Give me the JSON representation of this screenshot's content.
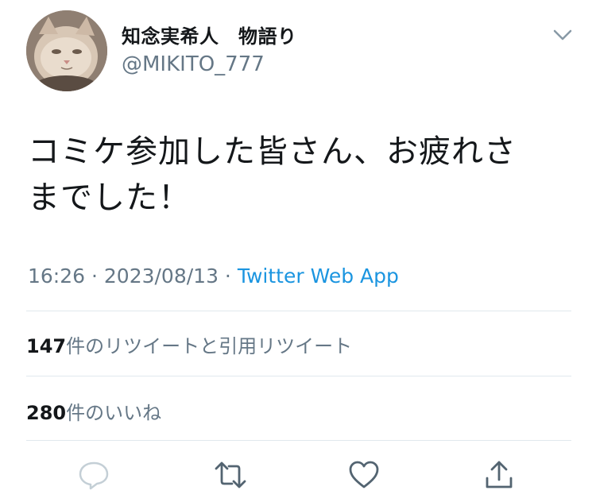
{
  "tweet": {
    "display_name": "知念実希人　物語り",
    "handle": "@MIKITO_777",
    "text_line1": "コミケ参加した皆さん、お疲れさ",
    "text_line2": "までした！",
    "time": "16:26",
    "date": "2023/08/13",
    "source": "Twitter Web App"
  },
  "stats": {
    "retweets_count": "147",
    "retweets_label": "件のリツイートと引用リツイート",
    "likes_count": "280",
    "likes_label": "件のいいね"
  },
  "icons": {
    "avatar": "cat-photo",
    "menu": "chevron-down-icon",
    "reply": "reply-icon",
    "retweet": "retweet-icon",
    "like": "heart-icon",
    "share": "share-icon"
  },
  "colors": {
    "text": "#14171a",
    "secondary": "#657786",
    "link": "#1b95e0",
    "divider": "#e1e8ed"
  }
}
